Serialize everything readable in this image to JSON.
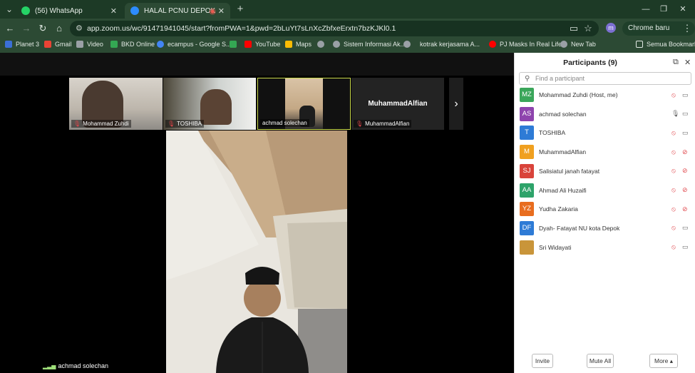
{
  "browser": {
    "tabs": [
      {
        "label": "(56) WhatsApp",
        "icon": "whatsapp-icon"
      },
      {
        "label": "HALAL PCNU DEPOK",
        "icon": "zoom-icon"
      }
    ],
    "url": "app.zoom.us/wc/91471941045/start?fromPWA=1&pwd=2bLuYt7sLnXcZbfxeErxtn7bzKJKl0.1",
    "update_pill": "Chrome baru tersedia",
    "profile_initial": "m",
    "bookmarks": [
      {
        "label": "Planet 3",
        "color": "#3b6fd6"
      },
      {
        "label": "Gmail",
        "color": "#ea4335"
      },
      {
        "label": "Video",
        "color": "#9aa0a6"
      },
      {
        "label": "BKD Online",
        "color": "#34a853"
      },
      {
        "label": "ecampus - Google S...",
        "color": "#4285f4"
      },
      {
        "label": "",
        "color": "#34a853"
      },
      {
        "label": "YouTube",
        "color": "#ff0000"
      },
      {
        "label": "Maps",
        "color": "#fbbc04"
      },
      {
        "label": "",
        "color": "#9aa0a6"
      },
      {
        "label": "Sistem Informasi Ak...",
        "color": "#9aa0a6"
      },
      {
        "label": "",
        "color": "#9aa0a6"
      },
      {
        "label": "kotrak kerjasama A...",
        "color": "#9aa0a6"
      },
      {
        "label": "PJ Masks In Real Life...",
        "color": "#ff0000"
      },
      {
        "label": "New Tab",
        "color": "#9aa0a6"
      }
    ],
    "all_bookmarks": "Semua Bookmark"
  },
  "gallery": [
    {
      "name": "Mohammad Zuhdi"
    },
    {
      "name": "TOSHIBA"
    },
    {
      "name": "achmad solechan"
    },
    {
      "name": "MuhammadAlfian",
      "placeholder": "MuhammadAlfian"
    }
  ],
  "active_speaker": "achmad solechan",
  "panel": {
    "title": "Participants (9)",
    "search_placeholder": "Find a participant",
    "participants": [
      {
        "initials": "MZ",
        "name": "Mohammad Zuhdi (Host, me)",
        "color": "#3aa65a",
        "mic": "muted",
        "cam": "on"
      },
      {
        "initials": "AS",
        "name": "achmad solechan",
        "color": "#8e44ad",
        "mic": "on",
        "cam": "on"
      },
      {
        "initials": "T",
        "name": "TOSHIBA",
        "color": "#2e7bd6",
        "mic": "muted",
        "cam": "on"
      },
      {
        "initials": "M",
        "name": "MuhammadAlfian",
        "color": "#f0a020",
        "mic": "muted",
        "cam": "off"
      },
      {
        "initials": "SJ",
        "name": "Salisiatul janah fatayat",
        "color": "#d9443b",
        "mic": "muted",
        "cam": "off"
      },
      {
        "initials": "AA",
        "name": "Ahmad Ali Huzaifi",
        "color": "#2ea36a",
        "mic": "muted",
        "cam": "off"
      },
      {
        "initials": "YZ",
        "name": "Yudha Zakaria",
        "color": "#e86d1f",
        "mic": "muted",
        "cam": "off"
      },
      {
        "initials": "DF",
        "name": "Dyah- Fatayat NU kota Depok",
        "color": "#2e7bd6",
        "mic": "muted",
        "cam": "on"
      },
      {
        "initials": "",
        "name": "Sri Widayati",
        "color": "#c9953a",
        "mic": "muted",
        "cam": "on"
      }
    ],
    "buttons": {
      "invite": "Invite",
      "mute_all": "Mute All",
      "more": "More ▴"
    }
  }
}
